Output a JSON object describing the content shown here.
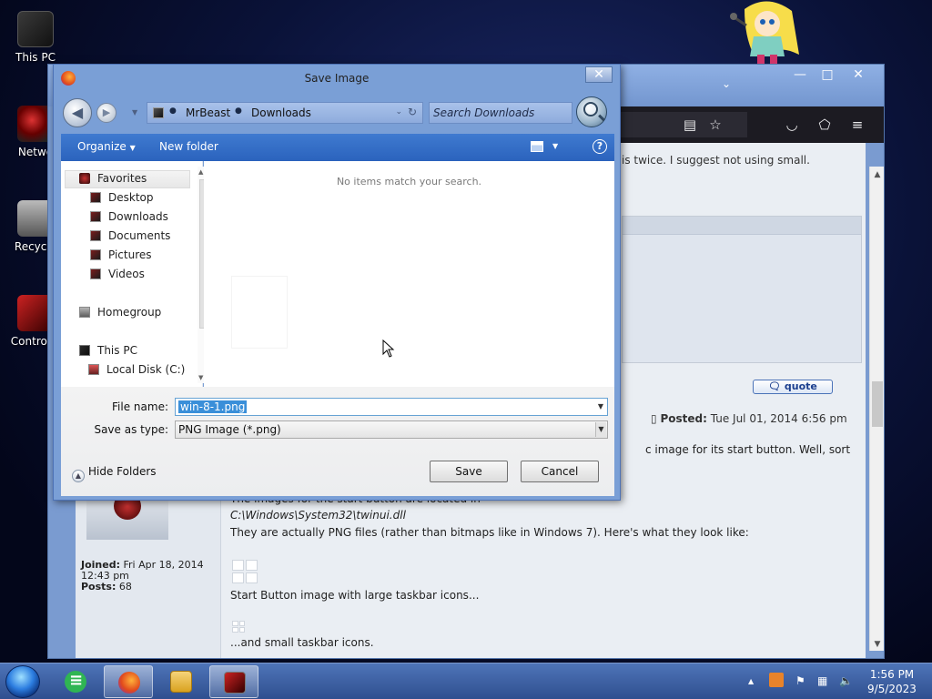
{
  "desktop": {
    "icons": [
      {
        "label": "This PC"
      },
      {
        "label": "Netwo"
      },
      {
        "label": "Recycle"
      },
      {
        "label": "Control P"
      }
    ]
  },
  "browser": {
    "window_controls": {
      "minimize": "—",
      "maximize": "□",
      "close": "✕"
    },
    "tab_dropdown": "⌄",
    "toolbar_icons": [
      "reader-icon",
      "star-icon",
      "pocket-icon",
      "extensions-icon",
      "menu-icon"
    ],
    "forum": {
      "top_text": "is twice. I suggest not using small.",
      "quote_label": "quote",
      "posted_label": "Posted:",
      "posted_date": "Tue Jul 01, 2014 6:56 pm",
      "line1": "c image for its start button. Well, sort",
      "line2": "The images for the start button are located in",
      "line3_path": "C:\\Windows\\System32\\twinui.dll",
      "line4": "They are actually PNG files (rather than bitmaps like in Windows 7). Here's what they look like:",
      "caption_large": "Start Button image with large taskbar icons...",
      "caption_small": "...and small taskbar icons.",
      "joined_label": "Joined:",
      "joined_value": "Fri Apr 18, 2014",
      "joined_time": "12:43 pm",
      "posts_label": "Posts:",
      "posts_value": "68"
    }
  },
  "dialog": {
    "title": "Save Image",
    "close": "✕",
    "breadcrumb": [
      "MrBeast",
      "Downloads"
    ],
    "search_placeholder": "Search Downloads",
    "toolbar": {
      "organize": "Organize",
      "new_folder": "New folder",
      "help": "?"
    },
    "tree": {
      "favorites": "Favorites",
      "desktop": "Desktop",
      "downloads": "Downloads",
      "documents": "Documents",
      "pictures": "Pictures",
      "videos": "Videos",
      "homegroup": "Homegroup",
      "this_pc": "This PC",
      "local_disk": "Local Disk (C:)"
    },
    "empty_message": "No items match your search.",
    "file_name_label": "File name:",
    "file_name_value": "win-8-1.png",
    "save_type_label": "Save as type:",
    "save_type_value": "PNG Image (*.png)",
    "hide_folders": "Hide Folders",
    "save_button": "Save",
    "cancel_button": "Cancel"
  },
  "taskbar": {
    "clock_time": "1:56 PM",
    "clock_date": "9/5/2023"
  }
}
